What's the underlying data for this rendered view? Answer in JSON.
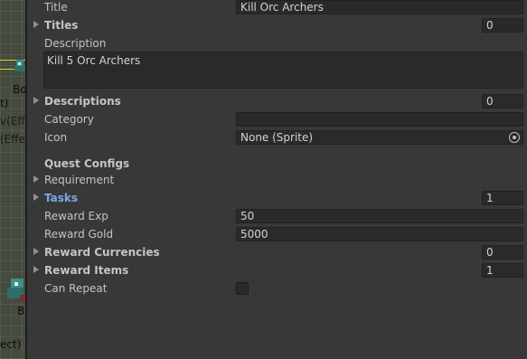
{
  "scene": {
    "labels": [
      "Bo",
      "t)",
      "v(Effe",
      "(Effe",
      "B",
      "ect)"
    ]
  },
  "inspector": {
    "title": {
      "label": "Title",
      "value": "Kill Orc Archers"
    },
    "titles": {
      "label": "Titles",
      "count": "0"
    },
    "description": {
      "label": "Description",
      "value": "Kill 5 Orc Archers"
    },
    "descriptions": {
      "label": "Descriptions",
      "count": "0"
    },
    "category": {
      "label": "Category",
      "value": ""
    },
    "icon": {
      "label": "Icon",
      "value": "None (Sprite)"
    },
    "quest_configs": {
      "label": "Quest Configs"
    },
    "requirement": {
      "label": "Requirement"
    },
    "tasks": {
      "label": "Tasks",
      "count": "1"
    },
    "reward_exp": {
      "label": "Reward Exp",
      "value": "50"
    },
    "reward_gold": {
      "label": "Reward Gold",
      "value": "5000"
    },
    "reward_currencies": {
      "label": "Reward Currencies",
      "count": "0"
    },
    "reward_items": {
      "label": "Reward Items",
      "count": "1"
    },
    "can_repeat": {
      "label": "Can Repeat",
      "checked": false
    }
  },
  "colors": {
    "panel_bg": "#383838",
    "field_bg": "#2a2a2a",
    "highlight_label": "#7aa9e0",
    "scene_gizmo_line": "#d7d31a"
  }
}
